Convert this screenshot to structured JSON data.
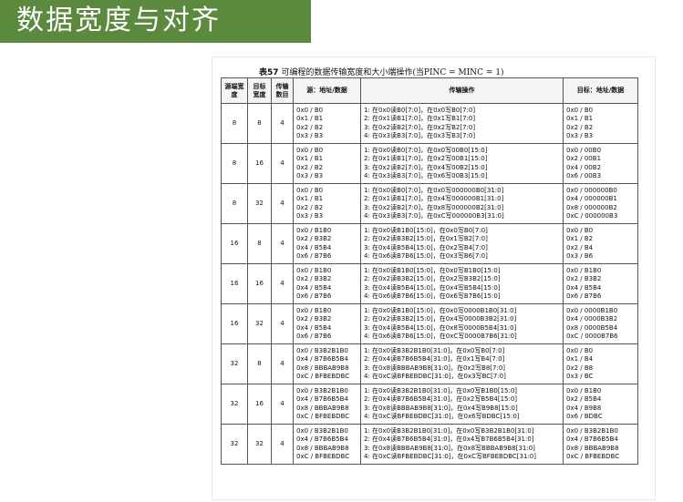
{
  "header": {
    "title": "数据宽度与对齐"
  },
  "caption": {
    "label": "表57",
    "text": "  可编程的数据传输宽度和大小端操作(当PINC = MINC = 1)"
  },
  "columns": [
    "源端宽度",
    "目标宽度",
    "传输数目",
    "源：地址/数据",
    "传输操作",
    "目标：地址/数据"
  ],
  "rows": [
    {
      "src_w": "8",
      "dst_w": "8",
      "count": "4",
      "src": "0x0 / B0\n0x1 / B1\n0x2 / B2\n0x3 / B3",
      "ops": "1: 在0x0读B0[7:0]，在0x0写B0[7:0]\n2: 在0x1读B1[7:0]，在0x1写B1[7:0]\n3: 在0x2读B2[7:0]，在0x2写B2[7:0]\n4: 在0x3读B3[7:0]，在0x3写B3[7:0]",
      "dst": "0x0 / B0\n0x1 / B1\n0x2 / B2\n0x3 / B3"
    },
    {
      "src_w": "8",
      "dst_w": "16",
      "count": "4",
      "src": "0x0 / B0\n0x1 / B1\n0x2 / B2\n0x3 / B3",
      "ops": "1: 在0x0读B0[7:0]，在0x0写00B0[15:0]\n2: 在0x1读B1[7:0]，在0x2写00B1[15:0]\n3: 在0x2读B2[7:0]，在0x4写00B2[15:0]\n4: 在0x3读B3[7:0]，在0x6写00B3[15:0]",
      "dst": "0x0 / 00B0\n0x2 / 00B1\n0x4 / 00B2\n0x6 / 00B3"
    },
    {
      "src_w": "8",
      "dst_w": "32",
      "count": "4",
      "src": "0x0 / B0\n0x1 / B1\n0x2 / B2\n0x3 / B3",
      "ops": "1: 在0x0读B0[7:0]，在0x0写000000B0[31:0]\n2: 在0x1读B1[7:0]，在0x4写000000B1[31:0]\n3: 在0x2读B2[7:0]，在0x8写000000B2[31:0]\n4: 在0x3读B3[7:0]，在0xC写000000B3[31:0]",
      "dst": "0x0 / 000000B0\n0x4 / 000000B1\n0x8 / 000000B2\n0xC / 000000B3"
    },
    {
      "src_w": "16",
      "dst_w": "8",
      "count": "4",
      "src": "0x0 / B1B0\n0x2 / B3B2\n0x4 / B5B4\n0x6 / B7B6",
      "ops": "1: 在0x0读B1B0[15:0]，在0x0写B0[7:0]\n2: 在0x2读B3B2[15:0]，在0x1写B2[7:0]\n3: 在0x4读B5B4[15:0]，在0x2写B4[7:0]\n4: 在0x6读B7B6[15:0]，在0x3写B6[7:0]",
      "dst": "0x0 / B0\n0x1 / B2\n0x2 / B4\n0x3 / B6"
    },
    {
      "src_w": "16",
      "dst_w": "16",
      "count": "4",
      "src": "0x0 / B1B0\n0x2 / B3B2\n0x4 / B5B4\n0x6 / B7B6",
      "ops": "1: 在0x0读B1B0[15:0]，在0x0写B1B0[15:0]\n2: 在0x2读B3B2[15:0]，在0x2写B3B2[15:0]\n3: 在0x4读B5B4[15:0]，在0x4写B5B4[15:0]\n4: 在0x6读B7B6[15:0]，在0x6写B7B6[15:0]",
      "dst": "0x0 / B1B0\n0x2 / B3B2\n0x4 / B5B4\n0x6 / B7B6"
    },
    {
      "src_w": "16",
      "dst_w": "32",
      "count": "4",
      "src": "0x0 / B1B0\n0x2 / B3B2\n0x4 / B5B4\n0x6 / B7B6",
      "ops": "1: 在0x0读B1B0[15:0]，在0x0写0000B1B0[31:0]\n2: 在0x2读B3B2[15:0]，在0x4写0000B3B2[31:0]\n3: 在0x4读B5B4[15:0]，在0x8写0000B5B4[31:0]\n4: 在0x6读B7B6[15:0]，在0xC写0000B7B6[31:0]",
      "dst": "0x0 / 0000B1B0\n0x4 / 0000B3B2\n0x8 / 0000B5B4\n0xC / 0000B7B6"
    },
    {
      "src_w": "32",
      "dst_w": "8",
      "count": "4",
      "src": "0x0 / B3B2B1B0\n0x4 / B7B6B5B4\n0x8 / BBBAB9B8\n0xC / BFBEBDBC",
      "ops": "1: 在0x0读B3B2B1B0[31:0]，在0x0写B0[7:0]\n2: 在0x4读B7B6B5B4[31:0]，在0x1写B4[7:0]\n3: 在0x8读BBBAB9B8[31:0]，在0x2写B8[7:0]\n4: 在0xC读BFBEBDBC[31:0]，在0x3写BC[7:0]",
      "dst": "0x0 / B0\n0x1 / B4\n0x2 / B8\n0x3 / BC"
    },
    {
      "src_w": "32",
      "dst_w": "16",
      "count": "4",
      "src": "0x0 / B3B2B1B0\n0x4 / B7B6B5B4\n0x8 / BBBAB9B8\n0xC / BFBEBDBC",
      "ops": "1: 在0x0读B3B2B1B0[31:0]，在0x0写B1B0[15:0]\n2: 在0x4读B7B6B5B4[31:0]，在0x2写B5B4[15:0]\n3: 在0x8读BBBAB9B8[31:0]，在0x4写B9B8[15:0]\n4: 在0xC读BFBEBDBC[31:0]，在0x6写BDBC[15:0]",
      "dst": "0x0 / B1B0\n0x2 / B5B4\n0x4 / B9B8\n0x6 / BDBC"
    },
    {
      "src_w": "32",
      "dst_w": "32",
      "count": "4",
      "src": "0x0 / B3B2B1B0\n0x4 / B7B6B5B4\n0x8 / BBBAB9B8\n0xC / BFBEBDBC",
      "ops": "1: 在0x0读B3B2B1B0[31:0]，在0x0写B3B2B1B0[31:0]\n2: 在0x4读B7B6B5B4[31:0]，在0x4写B7B6B5B4[31:0]\n3: 在0x8读BBBAB9B8[31:0]，在0x8写BBBAB9B8[31:0]\n4: 在0xC读BFBEBDBC[31:0]，在0xC写BFBEBDBC[31:0]",
      "dst": "0x0 / B3B2B1B0\n0x4 / B7B6B5B4\n0x8 / BBBAB9B8\n0xC / BFBEBDBC"
    }
  ]
}
